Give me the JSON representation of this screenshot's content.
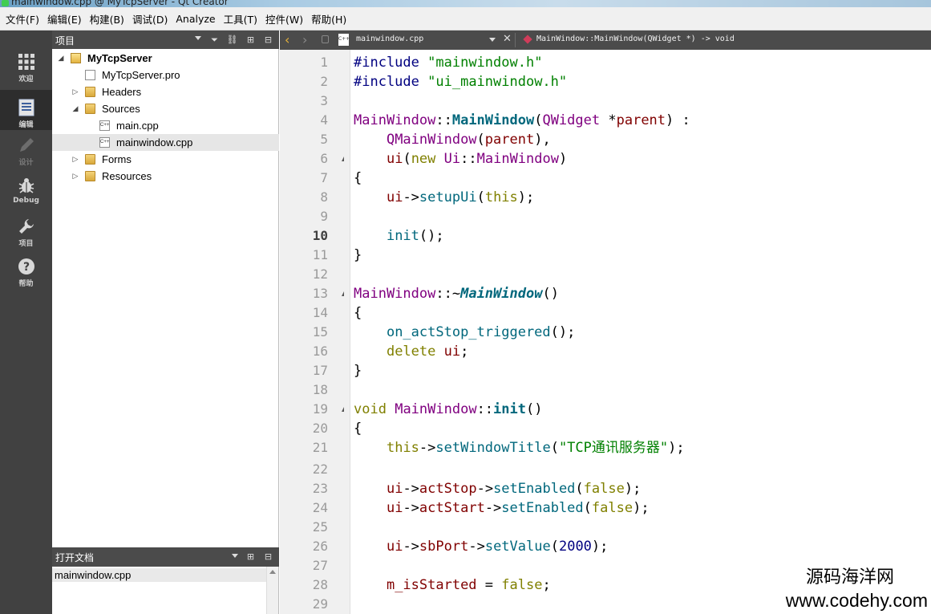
{
  "window": {
    "title": "mainwindow.cpp @ MyTcpServer - Qt Creator"
  },
  "menu": [
    "文件(F)",
    "编辑(E)",
    "构建(B)",
    "调试(D)",
    "Analyze",
    "工具(T)",
    "控件(W)",
    "帮助(H)"
  ],
  "modes": [
    {
      "label": "欢迎",
      "icon": "grid-icon",
      "active": false
    },
    {
      "label": "编辑",
      "icon": "document-icon",
      "active": true
    },
    {
      "label": "设计",
      "icon": "pencil-icon",
      "active": false
    },
    {
      "label": "Debug",
      "icon": "bug-icon",
      "active": false
    },
    {
      "label": "项目",
      "icon": "wrench-icon",
      "active": false
    },
    {
      "label": "帮助",
      "icon": "help-icon",
      "active": false
    }
  ],
  "project_panel": {
    "title": "项目",
    "tree": [
      {
        "label": "MyTcpServer",
        "level": 0,
        "expanded": true,
        "icon": "project-icon",
        "bold": true
      },
      {
        "label": "MyTcpServer.pro",
        "level": 1,
        "icon": "pro-file-icon"
      },
      {
        "label": "Headers",
        "level": 1,
        "expanded": false,
        "icon": "folder-icon"
      },
      {
        "label": "Sources",
        "level": 1,
        "expanded": true,
        "icon": "folder-icon"
      },
      {
        "label": "main.cpp",
        "level": 2,
        "icon": "cpp-file-icon"
      },
      {
        "label": "mainwindow.cpp",
        "level": 2,
        "icon": "cpp-file-icon",
        "selected": true
      },
      {
        "label": "Forms",
        "level": 1,
        "expanded": false,
        "icon": "folder-icon"
      },
      {
        "label": "Resources",
        "level": 1,
        "expanded": false,
        "icon": "folder-icon"
      }
    ]
  },
  "open_docs": {
    "title": "打开文档",
    "items": [
      "mainwindow.cpp"
    ]
  },
  "editor": {
    "file_name": "mainwindow.cpp",
    "symbol": "MainWindow::MainWindow(QWidget *) -> void",
    "current_line": 10,
    "line_numbers": [
      "1",
      "2",
      "3",
      "4",
      "5",
      "6",
      "7",
      "8",
      "9",
      "10",
      "11",
      "12",
      "13",
      "14",
      "15",
      "16",
      "17",
      "18",
      "19",
      "20",
      "21",
      "22",
      "23",
      "24",
      "25",
      "26",
      "27",
      "28",
      "29"
    ],
    "lines": [
      "#include \"mainwindow.h\"",
      "#include \"ui_mainwindow.h\"",
      "",
      "MainWindow::MainWindow(QWidget *parent) :",
      "    QMainWindow(parent),",
      "    ui(new Ui::MainWindow)",
      "{",
      "    ui->setupUi(this);",
      "",
      "    init();",
      "}",
      "",
      "MainWindow::~MainWindow()",
      "{",
      "    on_actStop_triggered();",
      "    delete ui;",
      "}",
      "",
      "void MainWindow::init()",
      "{",
      "    this->setWindowTitle(\"TCP通讯服务器\");",
      "",
      "    ui->actStop->setEnabled(false);",
      "    ui->actStart->setEnabled(false);",
      "",
      "    ui->sbPort->setValue(2000);",
      "",
      "    m_isStarted = false;",
      ""
    ]
  },
  "watermark": {
    "line1": "源码海洋网",
    "line2": "www.codehy.com"
  },
  "colors": {
    "keyword": "#808000",
    "string": "#008000",
    "class": "#800080",
    "function": "#00677c",
    "preprocessor": "#000080",
    "sidebar": "#414141",
    "toolbar": "#4b4b4b"
  }
}
